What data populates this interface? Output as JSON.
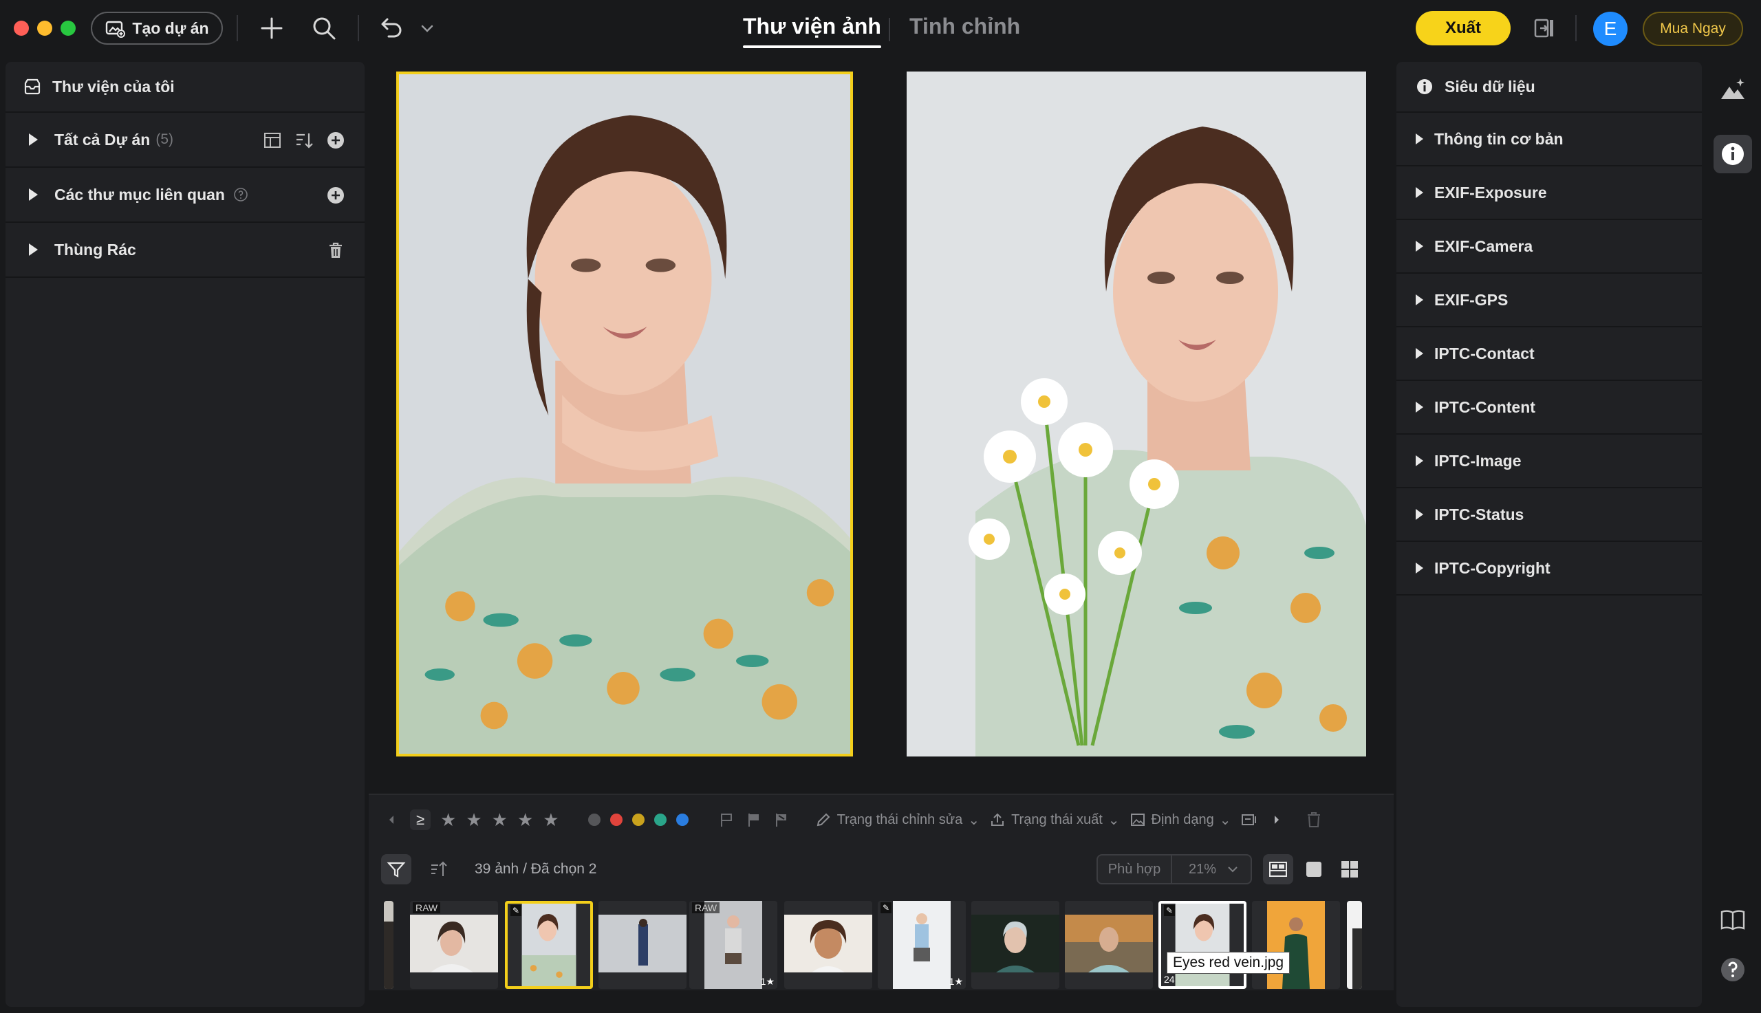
{
  "topbar": {
    "create_project_label": "Tạo dự án",
    "tabs": [
      {
        "label": "Thư viện ảnh",
        "active": true
      },
      {
        "label": "Tinh chỉnh",
        "active": false
      }
    ],
    "export_label": "Xuất",
    "avatar_initial": "E",
    "buy_label": "Mua Ngay",
    "accent_color": "#f7d31a",
    "avatar_color": "#1f8cff"
  },
  "left_panel": {
    "title": "Thư viện của tôi",
    "items": [
      {
        "label": "Tất cả Dự án",
        "count": "(5)"
      },
      {
        "label": "Các thư mục liên quan"
      },
      {
        "label": "Thùng Rác"
      }
    ]
  },
  "filter_bar": {
    "rating_operator": "≥",
    "stars": 5,
    "color_labels": [
      "#555659",
      "#e0443c",
      "#c9a21d",
      "#2aa58a",
      "#2a7de0"
    ],
    "edit_status_label": "Trạng thái chỉnh sửa",
    "export_status_label": "Trạng thái xuất",
    "format_label": "Định dạng"
  },
  "grid_bar": {
    "count_label": "39 ảnh / Đã chọn 2",
    "fit_label": "Phù hợp",
    "zoom_label": "21%"
  },
  "filmstrip": {
    "thumbs": [
      {
        "badge": ""
      },
      {
        "badge": "RAW"
      },
      {
        "badge": "edit",
        "selected": true
      },
      {
        "badge": ""
      },
      {
        "badge": "RAW",
        "rating": "1"
      },
      {
        "badge": ""
      },
      {
        "badge": "edit",
        "rating": "1"
      },
      {
        "badge": ""
      },
      {
        "badge": ""
      },
      {
        "badge": "edit",
        "hover": true,
        "index": "24"
      },
      {
        "badge": ""
      },
      {
        "badge": ""
      }
    ],
    "tooltip": "Eyes red vein.jpg"
  },
  "right_panel": {
    "title": "Siêu dữ liệu",
    "sections": [
      "Thông tin cơ bản",
      "EXIF-Exposure",
      "EXIF-Camera",
      "EXIF-GPS",
      "IPTC-Contact",
      "IPTC-Content",
      "IPTC-Image",
      "IPTC-Status",
      "IPTC-Copyright"
    ]
  }
}
